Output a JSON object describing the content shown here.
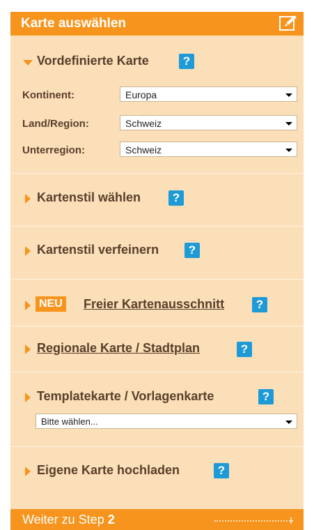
{
  "header": {
    "title": "Karte auswählen",
    "edit_icon": "edit-pencil-icon"
  },
  "predefined": {
    "title": "Vordefinierte Karte",
    "help": "?",
    "fields": [
      {
        "label": "Kontinent:",
        "value": "Europa"
      },
      {
        "label": "Land/Region:",
        "value": "Schweiz"
      },
      {
        "label": "Unterregion:",
        "value": "Schweiz"
      }
    ]
  },
  "sections": [
    {
      "title": "Kartenstil wählen",
      "help": "?"
    },
    {
      "title": "Kartenstil verfeinern",
      "help": "?"
    },
    {
      "badge": "NEU",
      "title": "Freier Kartenausschnitt",
      "help": "?"
    },
    {
      "title": "Regionale Karte / Stadtplan",
      "help": "?"
    },
    {
      "title": "Templatekarte / Vorlagenkarte",
      "help": "?",
      "select": "Bitte wählen..."
    },
    {
      "title": "Eigene Karte hochladen",
      "help": "?"
    }
  ],
  "footer": {
    "label": "Weiter zu Step",
    "step": "2"
  },
  "colors": {
    "accent": "#f7941d",
    "panel": "#fbdfb9",
    "help": "#1e9ad6",
    "text": "#5a3e2a"
  }
}
